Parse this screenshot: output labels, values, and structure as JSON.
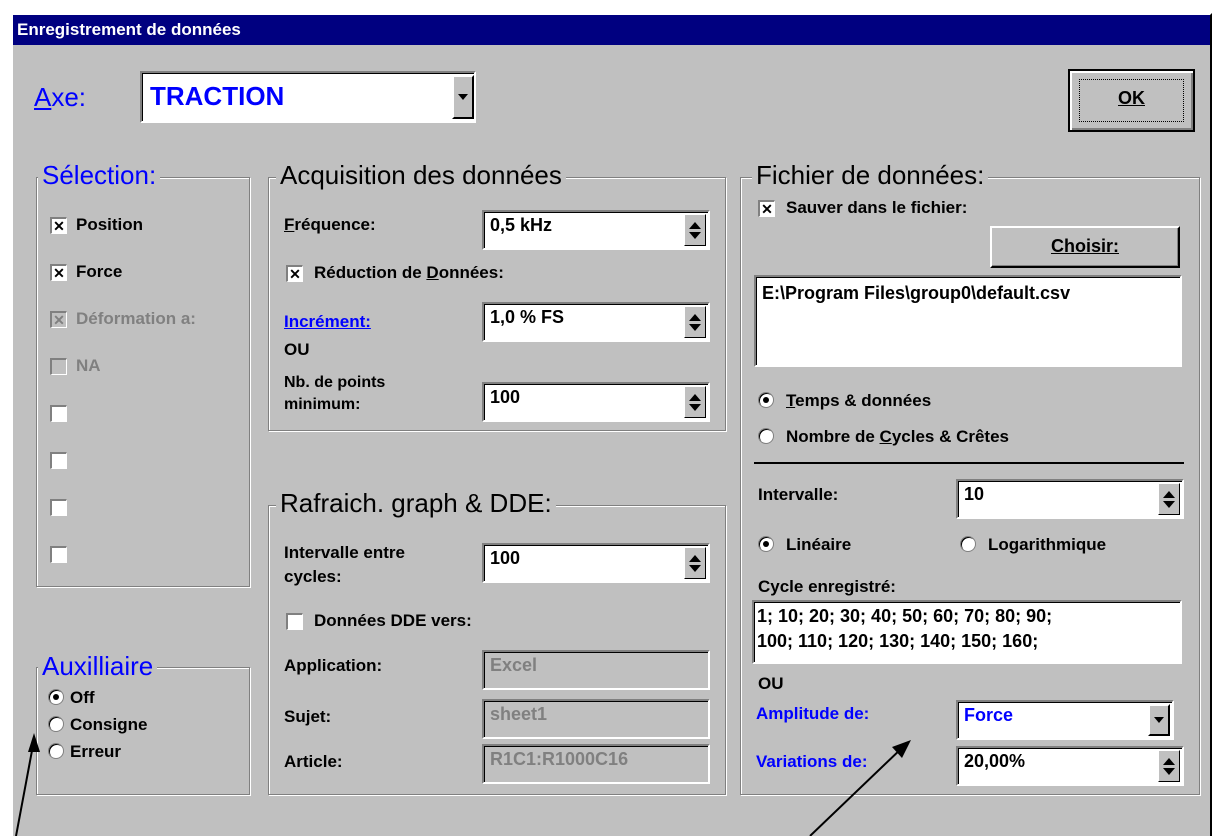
{
  "window": {
    "title": "Enregistrement de données"
  },
  "axe": {
    "label": "Axe:",
    "value": "TRACTION"
  },
  "ok_label": "OK",
  "selection": {
    "title": "Sélection:",
    "items": [
      {
        "label": "Position",
        "checked": true,
        "enabled": true
      },
      {
        "label": "Force",
        "checked": true,
        "enabled": true
      },
      {
        "label": "Déformation a:",
        "checked": true,
        "enabled": false
      },
      {
        "label": "NA",
        "checked": false,
        "enabled": false
      },
      {
        "label": "",
        "checked": false,
        "enabled": true
      },
      {
        "label": "",
        "checked": false,
        "enabled": true
      },
      {
        "label": "",
        "checked": false,
        "enabled": true
      },
      {
        "label": "",
        "checked": false,
        "enabled": true
      }
    ]
  },
  "auxilliaire": {
    "title": "Auxilliaire",
    "options": [
      {
        "label": "Off",
        "selected": true
      },
      {
        "label": "Consigne",
        "selected": false
      },
      {
        "label": "Erreur",
        "selected": false
      }
    ]
  },
  "acquisition": {
    "title": "Acquisition des données",
    "frequence_label": "Fréquence:",
    "frequence_value": "0,5 kHz",
    "reduction_label": "Réduction de Données:",
    "reduction_checked": true,
    "increment_label": "Incrément:",
    "increment_value": "1,0 % FS",
    "ou": "OU",
    "nb_points_label_1": "Nb. de points",
    "nb_points_label_2": "minimum:",
    "nb_points_value": "100"
  },
  "rafraich": {
    "title": "Rafraich. graph & DDE:",
    "intervalle_label_1": "Intervalle entre",
    "intervalle_label_2": "cycles:",
    "intervalle_value": "100",
    "dde_label": "Données DDE vers:",
    "dde_checked": false,
    "application_label": "Application:",
    "application_value": "Excel",
    "sujet_label": "Sujet:",
    "sujet_value": "sheet1",
    "article_label": "Article:",
    "article_value": "R1C1:R1000C16"
  },
  "fichier": {
    "title": "Fichier de données:",
    "sauver_label": "Sauver dans le fichier:",
    "sauver_checked": true,
    "choisir_label": "Choisir:",
    "path": "E:\\Program Files\\group0\\default.csv",
    "radio_temps": "Temps & données",
    "radio_cycles": "Nombre de Cycles & Crêtes",
    "intervalle_label": "Intervalle:",
    "intervalle_value": "10",
    "lineaire": "Linéaire",
    "logarithmique": "Logarithmique",
    "cycle_label": "Cycle enregistré:",
    "cycle_line1": "1; 10; 20; 30; 40; 50; 60; 70; 80; 90;",
    "cycle_line2": "100; 110; 120; 130; 140; 150; 160;",
    "ou": "OU",
    "amplitude_label": "Amplitude de:",
    "amplitude_value": "Force",
    "variations_label": "Variations de:",
    "variations_value": "20,00%"
  }
}
